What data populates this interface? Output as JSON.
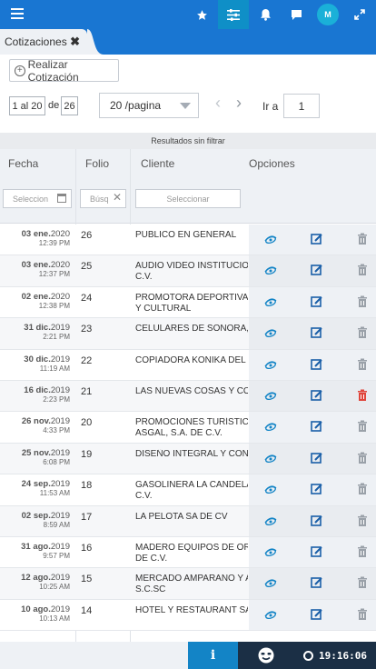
{
  "header": {
    "avatar_initial": "M",
    "icons": [
      "menu-icon",
      "star-icon",
      "sliders-icon",
      "bell-icon",
      "chat-icon",
      "expand-icon"
    ],
    "accent": "#1976d2"
  },
  "tab": {
    "label": "Cotizaciones",
    "close": "✖"
  },
  "toolbar": {
    "new_button": "Realizar Cotización"
  },
  "pager": {
    "range": "1 al 20",
    "of_label": "de",
    "total_pages": "26",
    "per_page": "20 /pagina",
    "goto_label": "Ir a",
    "goto_value": "1"
  },
  "filter_status": "Resultados sin filtrar",
  "table": {
    "headers": {
      "fecha": "Fecha",
      "folio": "Folio",
      "cliente": "Cliente",
      "opciones": "Opciones"
    },
    "filters": {
      "fecha_placeholder": "Seleccion",
      "folio_placeholder": "Búsq",
      "cliente_placeholder": "Seleccionar"
    },
    "rows": [
      {
        "day": "03 ene.",
        "year": "2020",
        "time": "12:39 PM",
        "folio": "26",
        "cliente": [
          "Publico En General"
        ],
        "delete_color": "#9aa1a9"
      },
      {
        "day": "03 ene.",
        "year": "2020",
        "time": "12:37 PM",
        "folio": "25",
        "cliente": [
          "AUDIO VIDEO INSTITUCIONAL",
          "C.V."
        ],
        "delete_color": "#9aa1a9"
      },
      {
        "day": "02 ene.",
        "year": "2020",
        "time": "12:38 PM",
        "folio": "24",
        "cliente": [
          "PROMOTORA DEPORTIVA",
          "Y CULTURAL"
        ],
        "delete_color": "#9aa1a9"
      },
      {
        "day": "31 dic.",
        "year": "2019",
        "time": "2:21 PM",
        "folio": "23",
        "cliente": [
          "CELULARES DE SONORA, S"
        ],
        "delete_color": "#9aa1a9"
      },
      {
        "day": "30 dic.",
        "year": "2019",
        "time": "11:19 AM",
        "folio": "22",
        "cliente": [
          "COPIADORA KONIKA DEL"
        ],
        "delete_color": "#9aa1a9"
      },
      {
        "day": "16 dic.",
        "year": "2019",
        "time": "2:23 PM",
        "folio": "21",
        "cliente": [
          "LAS NUEVAS COSAS Y COS"
        ],
        "delete_color": "#e0463c"
      },
      {
        "day": "26 nov.",
        "year": "2019",
        "time": "4:33 PM",
        "folio": "20",
        "cliente": [
          "PROMOCIONES TURÍSTICAS",
          "ASGAL, S.A. DE C.V."
        ],
        "delete_color": "#9aa1a9"
      },
      {
        "day": "25 nov.",
        "year": "2019",
        "time": "6:08 PM",
        "folio": "19",
        "cliente": [
          "DISEÑO INTEGRAL Y CON"
        ],
        "delete_color": "#9aa1a9"
      },
      {
        "day": "24 sep.",
        "year": "2019",
        "time": "11:53 AM",
        "folio": "18",
        "cliente": [
          "GASOLINERA LA CANDELA",
          "C.V."
        ],
        "delete_color": "#9aa1a9"
      },
      {
        "day": "02 sep.",
        "year": "2019",
        "time": "8:59 AM",
        "folio": "17",
        "cliente": [
          "LA PELOTA SA DE CV"
        ],
        "delete_color": "#9aa1a9"
      },
      {
        "day": "31 ago.",
        "year": "2019",
        "time": "9:57 PM",
        "folio": "16",
        "cliente": [
          "MADERO EQUIPOS DE OR",
          "DE C.V."
        ],
        "delete_color": "#9aa1a9"
      },
      {
        "day": "12 ago.",
        "year": "2019",
        "time": "10:25 AM",
        "folio": "15",
        "cliente": [
          "MERCADO AMPARANO Y A",
          "S.C.SC"
        ],
        "delete_color": "#9aa1a9"
      },
      {
        "day": "10 ago.",
        "year": "2019",
        "time": "10:13 AM",
        "folio": "14",
        "cliente": [
          "HOTEL Y RESTAURANT SA"
        ],
        "delete_color": "#9aa1a9"
      }
    ]
  },
  "statusbar": {
    "info": "i",
    "clock": "19:16:06"
  }
}
